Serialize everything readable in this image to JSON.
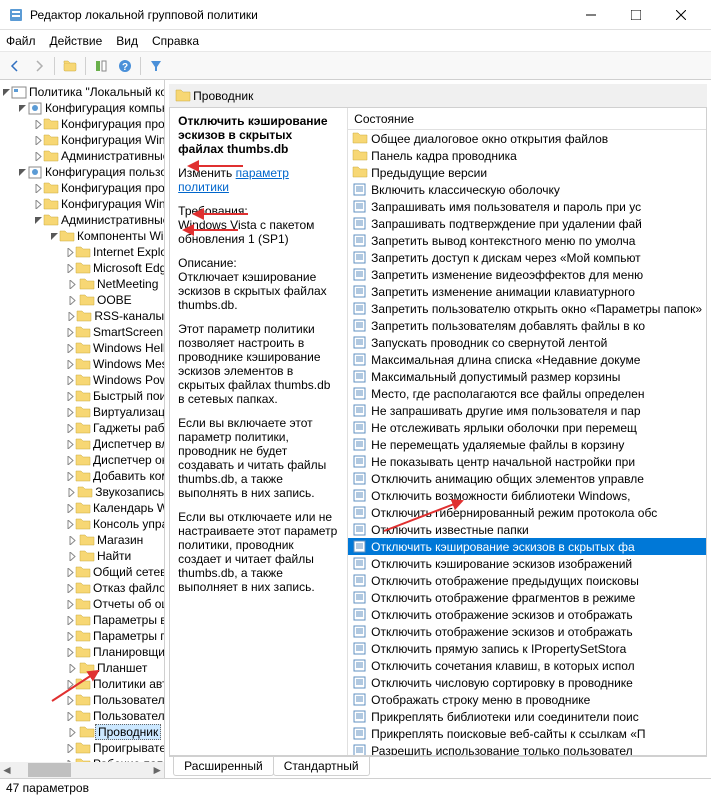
{
  "title": "Редактор локальной групповой политики",
  "menu": [
    "Файл",
    "Действие",
    "Вид",
    "Справка"
  ],
  "root": "Политика \"Локальный компьютер\"",
  "tree_cc": {
    "label": "Конфигурация компьютера",
    "children": [
      "Конфигурация программ",
      "Конфигурация Windows",
      "Административные шаблоны"
    ]
  },
  "tree_uc": {
    "label": "Конфигурация пользователя",
    "cp": "Конфигурация программ",
    "cw": "Конфигурация Windows",
    "at": "Административные шаблоны",
    "kw": "Компоненты Windows",
    "items": [
      "Internet Explorer",
      "Microsoft Edge",
      "NetMeeting",
      "OOBE",
      "RSS-каналы",
      "SmartScreen Защитника Win",
      "Windows Hello для бизнеса",
      "Windows Messenger",
      "Windows PowerShell",
      "Быстрый поиск",
      "Виртуализация средств взаи",
      "Гаджеты рабочего стола",
      "Диспетчер вложений",
      "Диспетчер окон рабочего с",
      "Добавить компоненты в Wi",
      "Звукозапись",
      "Календарь Windows",
      "Консоль управления (MMC)",
      "Магазин",
      "Найти",
      "Общий сетевой доступ",
      "Отказ файлов",
      "Отчеты об ошибках Window",
      "Параметры входа Windows",
      "Параметры презентации",
      "Планировщик заданий",
      "Планшет",
      "Политики автозапуска",
      "Пользовательский интерфе",
      "Пользовательский интерфе",
      "Проводник",
      "Проигрыватель Windows M",
      "Рабочие папки"
    ]
  },
  "breadcrumb": "Проводник",
  "desc": {
    "title": "Отключить кэширование эскизов в скрытых файлах thumbs.db",
    "edit": "Изменить",
    "editlink": "параметр политики",
    "req_h": "Требования:",
    "req": "Windows Vista с пакетом обновления 1 (SP1)",
    "d_h": "Описание:",
    "d1": "Отключает кэширование эскизов в скрытых файлах thumbs.db.",
    "d2": "Этот параметр политики позволяет настроить в проводнике кэширование эскизов элементов в скрытых файлах thumbs.db в сетевых папках.",
    "d3": "Если вы включаете этот параметр политики, проводник не будет создавать и читать файлы thumbs.db, а также выполнять в них запись.",
    "d4": "Если вы отключаете или не настраиваете этот параметр политики, проводник создает и читает файлы thumbs.db, а также выполняет в них запись."
  },
  "listheader": "Состояние",
  "folders": [
    "Общее диалоговое окно открытия файлов",
    "Панель кадра проводника",
    "Предыдущие версии"
  ],
  "settings": [
    "Включить классическую оболочку",
    "Запрашивать имя пользователя и пароль при ус",
    "Запрашивать подтверждение при удалении фай",
    "Запретить вывод контекстного меню по умолча",
    "Запретить доступ к дискам через «Мой компьют",
    "Запретить изменение видеоэффектов для меню",
    "Запретить изменение анимации клавиатурного",
    "Запретить пользователю открыть окно «Параметры папок»",
    "Запретить пользователям добавлять файлы в ко",
    "Запускать проводник со свернутой лентой",
    "Максимальная длина списка «Недавние докуме",
    "Максимальный допустимый размер корзины",
    "Место, где располагаются все файлы определен",
    "Не запрашивать другие имя пользователя и пар",
    "Не отслеживать ярлыки оболочки при перемещ",
    "Не перемещать удаляемые файлы в корзину",
    "Не показывать центр начальной настройки при",
    "Отключить анимацию общих элементов управле",
    "Отключить возможности библиотеки Windows,",
    "Отключить гибернированный режим протокола обс",
    "Отключить известные папки",
    "Отключить кэширование эскизов в скрытых фа",
    "Отключить кэширование эскизов изображений",
    "Отключить отображение предыдущих поисковы",
    "Отключить отображение фрагментов в режиме",
    "Отключить отображение эскизов и отображать",
    "Отключить отображение эскизов и отображать",
    "Отключить прямую запись к IPropertySetStora",
    "Отключить сочетания клавиш, в которых испол",
    "Отключить числовую сортировку в проводнике",
    "Отображать строку меню в проводнике",
    "Прикреплять библиотеки или соединители поис",
    "Прикреплять поисковые веб-сайты к ссылкам «П",
    "Разрешить использование только пользовател"
  ],
  "sel_index": 21,
  "tabs": [
    "Расширенный",
    "Стандартный"
  ],
  "status": "47 параметров"
}
